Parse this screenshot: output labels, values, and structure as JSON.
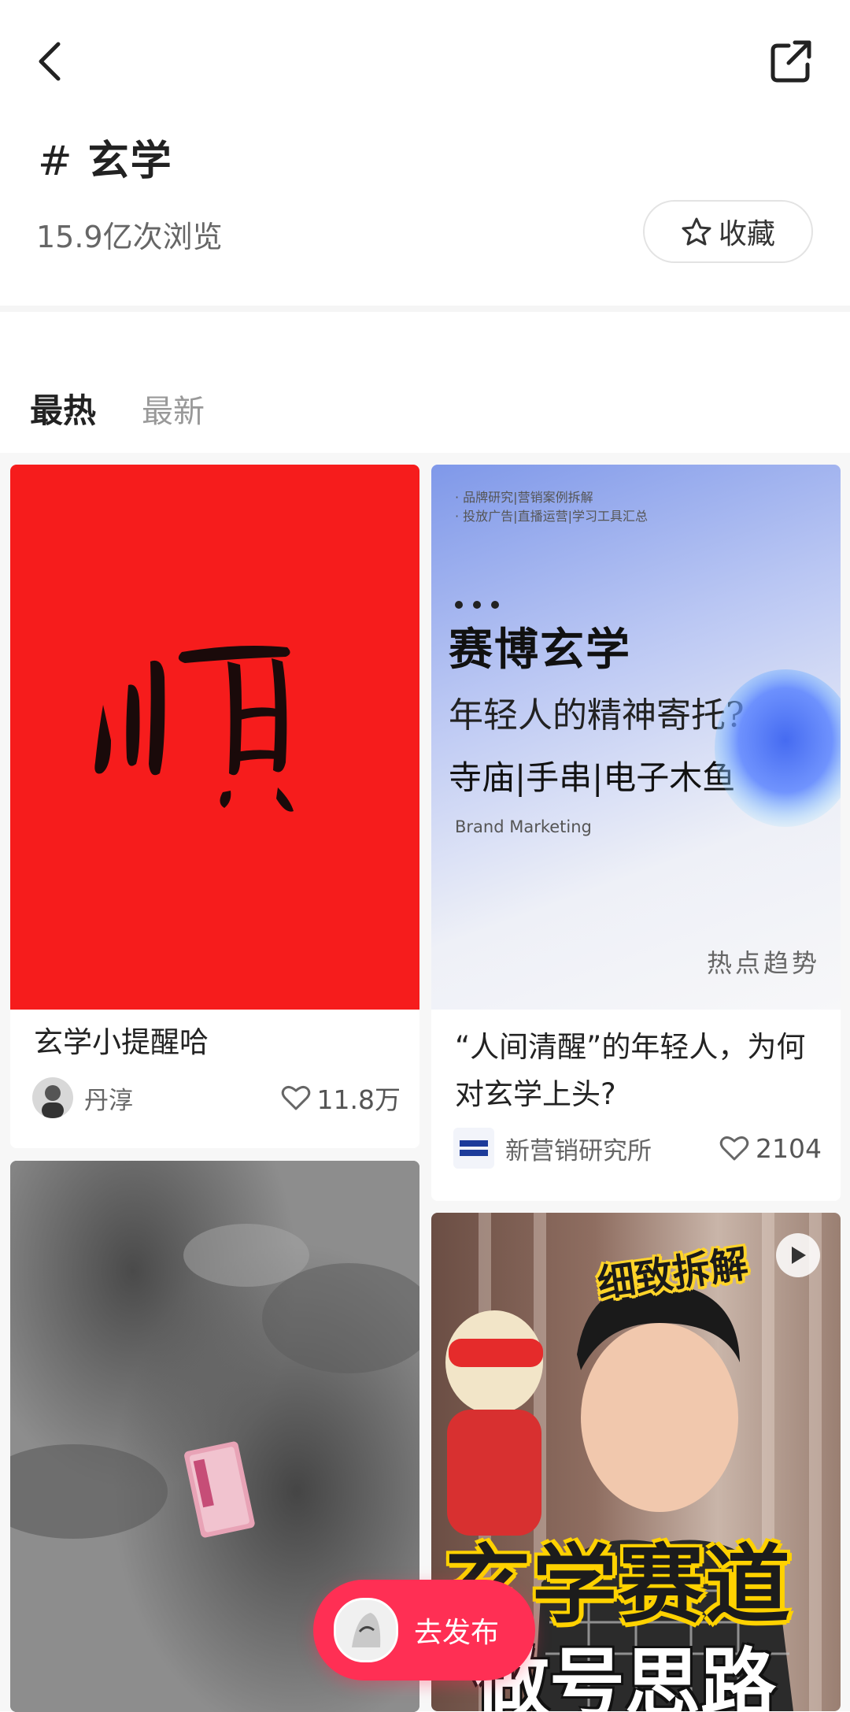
{
  "header": {
    "back_icon": "chevron-left-icon",
    "share_icon": "share-external-icon",
    "topic_hash": "#",
    "topic_name": "玄学",
    "views": "15.9亿次浏览",
    "favorite_label": "收藏",
    "favorite_icon": "star-outline-icon"
  },
  "tabs": [
    {
      "label": "最热",
      "active": true
    },
    {
      "label": "最新",
      "active": false
    }
  ],
  "feed": {
    "cards": [
      {
        "cover_text": "顺",
        "cover_color": "#f61c1c",
        "title": "玄学小提醒哈",
        "author": "丹淳",
        "likes": "11.8万"
      },
      {
        "cover": {
          "line1": "· 品牌研究|营销案例拆解",
          "line2": "· 投放广告|直播运营|学习工具汇总",
          "heading": "赛博玄学",
          "sub": "年轻人的精神寄托?",
          "tags": "寺庙|手串|电子木鱼",
          "brand": "Brand Marketing",
          "trend": "热点趋势"
        },
        "title": "“人间清醒”的年轻人，为何对玄学上头?",
        "author": "新营销研究所",
        "author_badge": "新营销研究所",
        "likes": "2104"
      },
      {
        "cover_description_icon": "photo-icon"
      },
      {
        "cover": {
          "banner": "细致拆解",
          "big": "玄学赛道",
          "big2": "做号思路"
        },
        "video_icon": "play-icon"
      }
    ]
  },
  "publish_button": {
    "label": "去发布"
  },
  "colors": {
    "accent": "#ff2f54",
    "red_cover": "#f61c1c"
  }
}
